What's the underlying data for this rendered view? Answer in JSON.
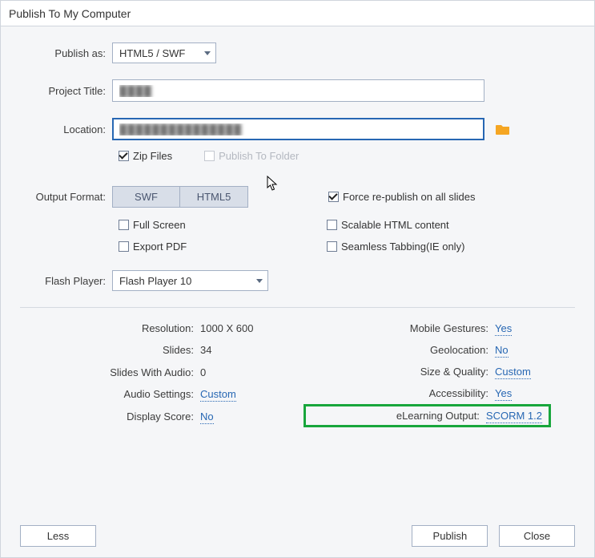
{
  "title": "Publish To My Computer",
  "labels": {
    "publish_as": "Publish as:",
    "project_title": "Project Title:",
    "location": "Location:",
    "zip_files": "Zip Files",
    "publish_to_folder": "Publish To Folder",
    "output_format": "Output Format:",
    "swf": "SWF",
    "html5": "HTML5",
    "full_screen": "Full Screen",
    "export_pdf": "Export PDF",
    "force_republish": "Force re-publish on all slides",
    "scalable_html": "Scalable HTML content",
    "seamless_tab": "Seamless Tabbing(IE only)",
    "flash_player": "Flash Player:"
  },
  "fields": {
    "publish_as_value": "HTML5 / SWF",
    "project_title_value": "████",
    "location_value": "███████████████",
    "flash_player_value": "Flash Player 10"
  },
  "checks": {
    "zip_files": true,
    "publish_to_folder": false,
    "swf_active": true,
    "html5_active": true,
    "full_screen": false,
    "export_pdf": false,
    "force_republish": true,
    "scalable_html": false,
    "seamless_tab": false
  },
  "summary": {
    "left": {
      "resolution_label": "Resolution:",
      "resolution_value": "1000 X 600",
      "slides_label": "Slides:",
      "slides_value": "34",
      "slides_audio_label": "Slides With Audio:",
      "slides_audio_value": "0",
      "audio_settings_label": "Audio Settings:",
      "audio_settings_value": "Custom",
      "display_score_label": "Display Score:",
      "display_score_value": "No"
    },
    "right": {
      "mobile_gestures_label": "Mobile Gestures:",
      "mobile_gestures_value": "Yes",
      "geolocation_label": "Geolocation:",
      "geolocation_value": "No",
      "size_quality_label": "Size & Quality:",
      "size_quality_value": "Custom",
      "accessibility_label": "Accessibility:",
      "accessibility_value": "Yes",
      "elearning_label": "eLearning Output:",
      "elearning_value": "SCORM 1.2"
    }
  },
  "buttons": {
    "less": "Less",
    "publish": "Publish",
    "close": "Close"
  }
}
